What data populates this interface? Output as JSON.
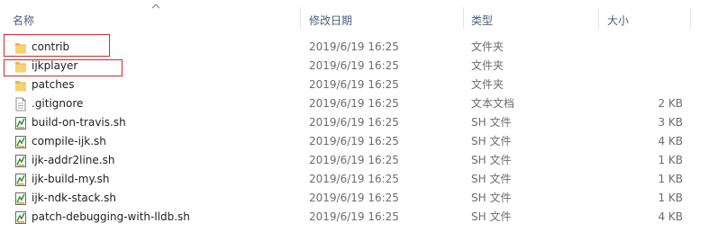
{
  "columns": {
    "name": "名称",
    "date": "修改日期",
    "type": "类型",
    "size": "大小"
  },
  "files": [
    {
      "name": "contrib",
      "date": "2019/6/19 16:25",
      "type": "文件夹",
      "size": "",
      "icon": "folder-icon",
      "highlighted": true
    },
    {
      "name": "ijkplayer",
      "date": "2019/6/19 16:25",
      "type": "文件夹",
      "size": "",
      "icon": "folder-icon",
      "highlighted": true
    },
    {
      "name": "patches",
      "date": "2019/6/19 16:25",
      "type": "文件夹",
      "size": "",
      "icon": "folder-icon",
      "highlighted": false
    },
    {
      "name": ".gitignore",
      "date": "2019/6/19 16:25",
      "type": "文本文档",
      "size": "2 KB",
      "icon": "text-file-icon",
      "highlighted": false
    },
    {
      "name": "build-on-travis.sh",
      "date": "2019/6/19 16:25",
      "type": "SH 文件",
      "size": "3 KB",
      "icon": "sh-file-icon",
      "highlighted": false
    },
    {
      "name": "compile-ijk.sh",
      "date": "2019/6/19 16:25",
      "type": "SH 文件",
      "size": "4 KB",
      "icon": "sh-file-icon",
      "highlighted": false
    },
    {
      "name": "ijk-addr2line.sh",
      "date": "2019/6/19 16:25",
      "type": "SH 文件",
      "size": "1 KB",
      "icon": "sh-file-icon",
      "highlighted": false
    },
    {
      "name": "ijk-build-my.sh",
      "date": "2019/6/19 16:25",
      "type": "SH 文件",
      "size": "1 KB",
      "icon": "sh-file-icon",
      "highlighted": false
    },
    {
      "name": "ijk-ndk-stack.sh",
      "date": "2019/6/19 16:25",
      "type": "SH 文件",
      "size": "1 KB",
      "icon": "sh-file-icon",
      "highlighted": false
    },
    {
      "name": "patch-debugging-with-lldb.sh",
      "date": "2019/6/19 16:25",
      "type": "SH 文件",
      "size": "4 KB",
      "icon": "sh-file-icon",
      "highlighted": false
    }
  ],
  "colors": {
    "highlight": "#e0232a",
    "folder": "#f3c94e",
    "header_text": "#4c607a"
  }
}
